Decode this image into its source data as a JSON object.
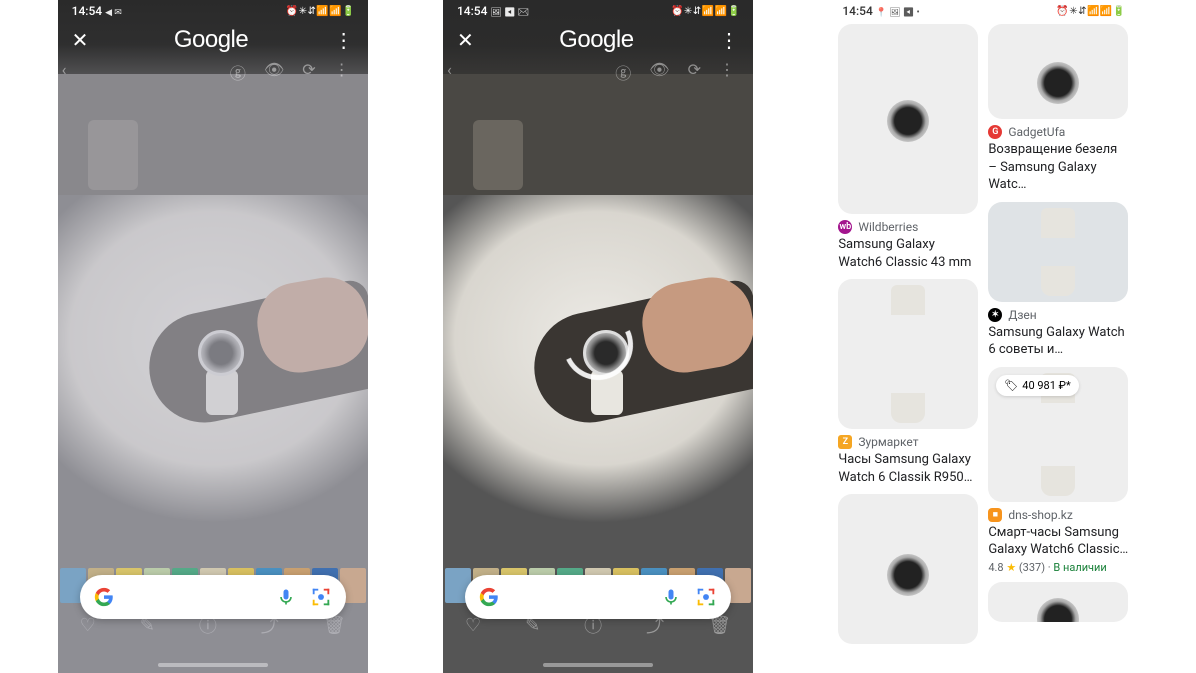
{
  "status": {
    "time_a": "14:54",
    "time_b": "14:54",
    "time_c": "14:54",
    "left_icons_a": "◀ ✉",
    "left_icons_b": "🖼 ◀ ✉",
    "left_icons_c": "📍 🖼 ◀ •",
    "right_icons": "⏰ ✳ ⇵ 📶 📶 🔋"
  },
  "header": {
    "brand": "Google"
  },
  "results": {
    "left": [
      {
        "source": "Wildberries",
        "title": "Samsung Galaxy Watch6 Classic 43 mm"
      },
      {
        "source": "Зурмаркет",
        "title": "Часы Samsung Galaxy Watch 6 Classik R950…"
      }
    ],
    "right": [
      {
        "source": "GadgetUfa",
        "title": "Возвращение безеля – Samsung Galaxy Watc…"
      },
      {
        "source": "Дзен",
        "title": "Samsung Galaxy Watch 6 советы и…"
      },
      {
        "price": "40 981 ₽*",
        "source": "dns-shop.kz",
        "title": "Смарт-часы Samsung Galaxy Watch6 Classic…",
        "rating": "4.8",
        "reviews": "(337)",
        "stock": "В наличии"
      }
    ]
  }
}
